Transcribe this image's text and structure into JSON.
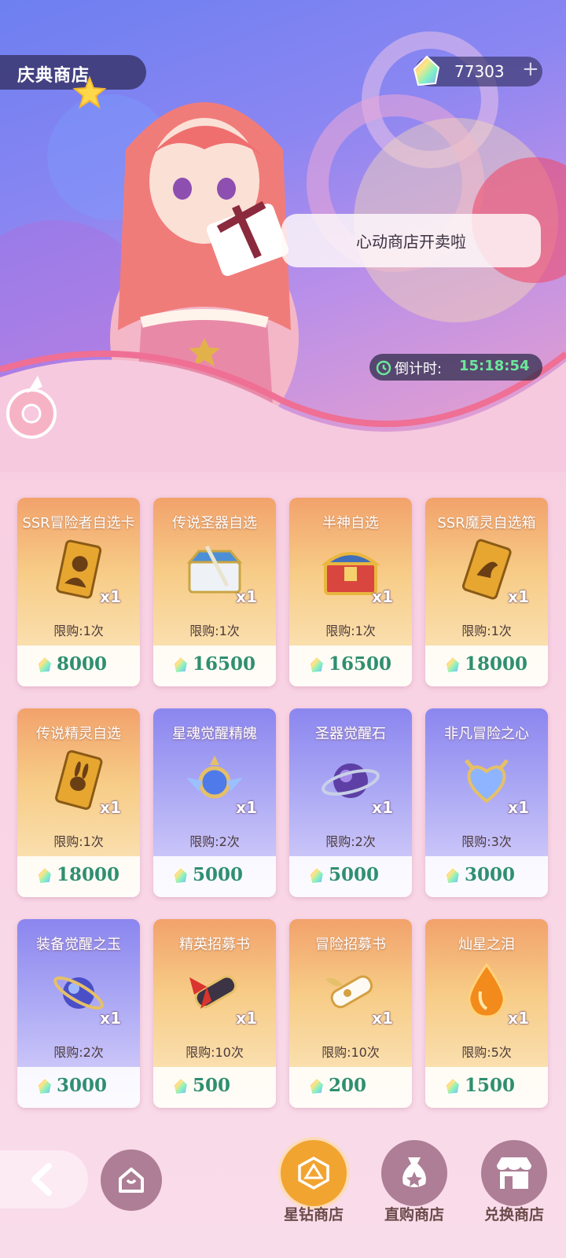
{
  "header": {
    "title": "庆典商店"
  },
  "currency": {
    "amount": "77303",
    "plus": "+",
    "icon": "rainbow-gem-icon"
  },
  "banner": {
    "speech": "心动商店开卖啦",
    "countdown_label": "倒计时:",
    "countdown_time": "15:18:54"
  },
  "colors": {
    "price": "#2f8f70",
    "countdown": "#6ee79a",
    "active_nav": "#f2a431"
  },
  "shop": {
    "items": [
      {
        "name": "SSR冒险者自选卡",
        "qty": "x1",
        "limit": "限购:1次",
        "price": "8000",
        "icon": "golden-hero-card-icon",
        "theme": "gold"
      },
      {
        "name": "传说圣器自选",
        "qty": "x1",
        "limit": "限购:1次",
        "price": "16500",
        "icon": "weapon-chest-icon",
        "theme": "gold"
      },
      {
        "name": "半神自选",
        "qty": "x1",
        "limit": "限购:1次",
        "price": "16500",
        "icon": "treasure-chest-icon",
        "theme": "gold"
      },
      {
        "name": "SSR魔灵自选箱",
        "qty": "x1",
        "limit": "限购:1次",
        "price": "18000",
        "icon": "golden-dragon-card-icon",
        "theme": "gold"
      },
      {
        "name": "传说精灵自选",
        "qty": "x1",
        "limit": "限购:1次",
        "price": "18000",
        "icon": "golden-rabbit-card-icon",
        "theme": "gold"
      },
      {
        "name": "星魂觉醒精魄",
        "qty": "x1",
        "limit": "限购:2次",
        "price": "5000",
        "icon": "star-soul-crystal-icon",
        "theme": "purple"
      },
      {
        "name": "圣器觉醒石",
        "qty": "x1",
        "limit": "限购:2次",
        "price": "5000",
        "icon": "purple-orb-icon",
        "theme": "purple"
      },
      {
        "name": "非凡冒险之心",
        "qty": "x1",
        "limit": "限购:3次",
        "price": "3000",
        "icon": "heart-crystal-icon",
        "theme": "purple"
      },
      {
        "name": "装备觉醒之玉",
        "qty": "x1",
        "limit": "限购:2次",
        "price": "3000",
        "icon": "blue-jade-orb-icon",
        "theme": "purple"
      },
      {
        "name": "精英招募书",
        "qty": "x1",
        "limit": "限购:10次",
        "price": "500",
        "icon": "elite-scroll-icon",
        "theme": "gold"
      },
      {
        "name": "冒险招募书",
        "qty": "x1",
        "limit": "限购:10次",
        "price": "200",
        "icon": "winged-scroll-icon",
        "theme": "gold"
      },
      {
        "name": "灿星之泪",
        "qty": "x1",
        "limit": "限购:5次",
        "price": "1500",
        "icon": "orange-teardrop-icon",
        "theme": "gold"
      }
    ]
  },
  "nav": {
    "back_icon": "chevron-left-icon",
    "home_icon": "home-icon",
    "tabs": [
      {
        "label": "星钻商店",
        "icon": "d20-dice-icon",
        "active": true
      },
      {
        "label": "直购商店",
        "icon": "money-bag-icon",
        "active": false
      },
      {
        "label": "兑换商店",
        "icon": "shop-stall-icon",
        "active": false
      }
    ]
  }
}
